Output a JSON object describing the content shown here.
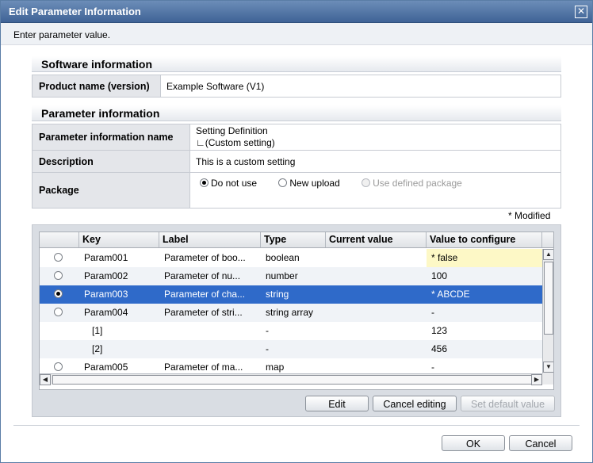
{
  "window": {
    "title": "Edit Parameter Information",
    "close_glyph": "✕"
  },
  "instruction": "Enter parameter value.",
  "software": {
    "section_title": "Software information",
    "product_label": "Product name (version)",
    "product_value": "Example Software (V1)"
  },
  "parameter": {
    "section_title": "Parameter information",
    "name_label": "Parameter information name",
    "name_line1": "Setting Definition",
    "name_line2": "∟(Custom setting)",
    "description_label": "Description",
    "description_value": "This is a custom setting",
    "package_label": "Package",
    "package_options": [
      {
        "label": "Do not use",
        "selected": true,
        "disabled": false
      },
      {
        "label": "New upload",
        "selected": false,
        "disabled": false
      },
      {
        "label": "Use defined package",
        "selected": false,
        "disabled": true
      }
    ]
  },
  "modified_note": "* Modified",
  "grid": {
    "columns": [
      "",
      "Key",
      "Label",
      "Type",
      "Current value",
      "Value to configure"
    ],
    "rows": [
      {
        "key": "Param001",
        "label": "Parameter of boo...",
        "type": "boolean",
        "current": "",
        "value": "* false",
        "radio": true,
        "selected": false,
        "modified": true
      },
      {
        "key": "Param002",
        "label": "Parameter of nu...",
        "type": "number",
        "current": "",
        "value": "100",
        "radio": true,
        "selected": false,
        "modified": false
      },
      {
        "key": "Param003",
        "label": "Parameter of cha...",
        "type": "string",
        "current": "",
        "value": "* ABCDE",
        "radio": true,
        "selected": true,
        "modified": true
      },
      {
        "key": "Param004",
        "label": "Parameter of stri...",
        "type": "string array",
        "current": "",
        "value": "-",
        "radio": true,
        "selected": false,
        "modified": false
      },
      {
        "key": "[1]",
        "label": "",
        "type": "-",
        "current": "",
        "value": "123",
        "radio": false,
        "selected": false,
        "modified": false,
        "indent": true
      },
      {
        "key": "[2]",
        "label": "",
        "type": "-",
        "current": "",
        "value": "456",
        "radio": false,
        "selected": false,
        "modified": false,
        "indent": true
      },
      {
        "key": "Param005",
        "label": "Parameter of ma...",
        "type": "map",
        "current": "",
        "value": "-",
        "radio": true,
        "selected": false,
        "modified": false
      }
    ]
  },
  "buttons": {
    "edit": "Edit",
    "cancel_editing": "Cancel editing",
    "set_default": "Set default value",
    "ok": "OK",
    "cancel": "Cancel"
  }
}
